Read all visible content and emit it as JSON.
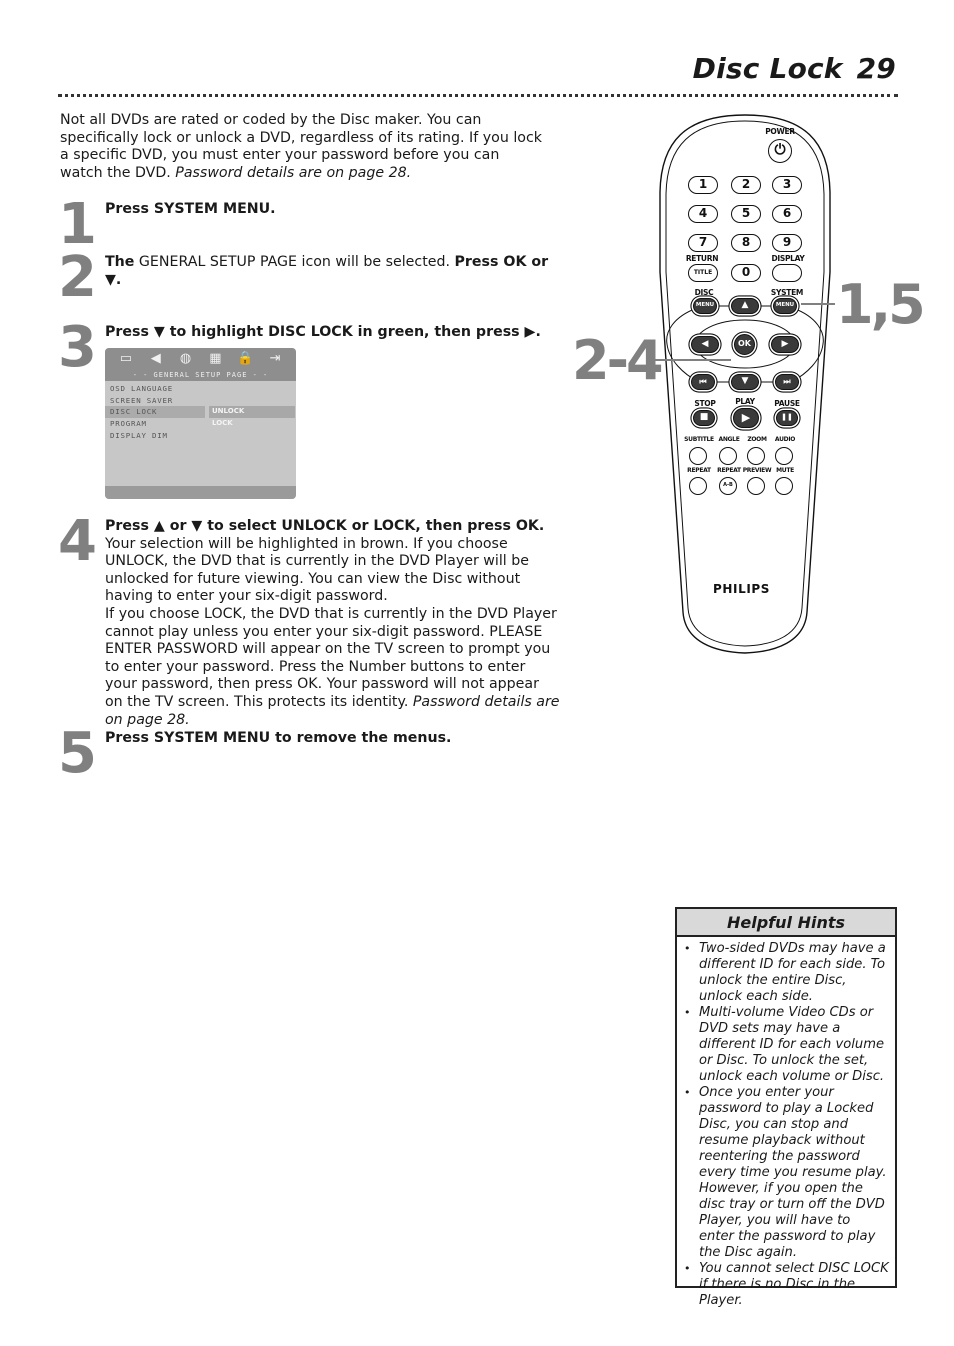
{
  "header": {
    "title": "Disc Lock",
    "page_number": "29"
  },
  "intro": {
    "text": "Not all DVDs are rated or coded by the Disc maker. You can specifically lock or unlock a DVD, regardless of its rating. If you lock a specific DVD, you must enter your password before you can watch the DVD. ",
    "italic_note": "Password details are on page 28."
  },
  "steps": [
    {
      "number": "1",
      "parts": [
        {
          "b": "Press SYSTEM MENU."
        }
      ]
    },
    {
      "number": "2",
      "parts": [
        {
          "b": "The"
        },
        {
          "t": " GENERAL SETUP PAGE icon will be selected. "
        },
        {
          "b": "Press OK or ▼."
        }
      ]
    },
    {
      "number": "3",
      "parts": [
        {
          "b": "Press ▼  to highlight DISC LOCK in green, then press ▶."
        }
      ]
    },
    {
      "number": "4",
      "parts": [
        {
          "b": "Press ▲ or ▼ to select UNLOCK or LOCK, then press OK."
        },
        {
          "t": " Your selection will be highlighted in brown. If you choose UNLOCK, the DVD that is currently in the DVD Player will be unlocked for future viewing. You can view the Disc without having to enter your six-digit password."
        },
        {
          "br": true
        },
        {
          "t": "If you choose LOCK, the DVD that is currently in the DVD Player cannot play unless you enter your six-digit password. PLEASE ENTER PASSWORD will appear on the TV screen to prompt you to enter your password. Press the Number buttons to enter your password, then press OK.  Your password will not appear on the TV screen. This protects its identity. "
        },
        {
          "i": "Password details are on page 28."
        }
      ]
    },
    {
      "number": "5",
      "parts": [
        {
          "b": "Press SYSTEM MENU to remove the menus."
        }
      ]
    }
  ],
  "osd": {
    "icons": [
      "tv-icon",
      "speaker-icon",
      "disc-icon",
      "picture-icon",
      "lock-icon",
      "exit-icon"
    ],
    "icon_glyphs": [
      "▭",
      "◀",
      "◍",
      "▦",
      "🔒",
      "⇥"
    ],
    "title": "- -  GENERAL  SETUP  PAGE  - -",
    "items": [
      "OSD LANGUAGE",
      "SCREEN SAVER",
      "DISC LOCK",
      "PROGRAM",
      "DISPLAY DIM"
    ],
    "selected_item": "DISC LOCK",
    "options": [
      "UNLOCK",
      "LOCK"
    ],
    "selected_option": "UNLOCK"
  },
  "remote": {
    "power_label": "POWER",
    "numbers": [
      "1",
      "2",
      "3",
      "4",
      "5",
      "6",
      "7",
      "8",
      "9"
    ],
    "zero": "0",
    "return_label": "RETURN",
    "title_button": "TITLE",
    "display_label": "DISPLAY",
    "disc_label": "DISC",
    "system_label": "SYSTEM",
    "menu_button": "MENU",
    "ok_button": "OK",
    "up": "▲",
    "down": "▼",
    "left": "◀",
    "right": "▶",
    "prev": "⏮",
    "next": "⏭",
    "stop_label": "STOP",
    "play_label": "PLAY",
    "pause_label": "PAUSE",
    "stop_glyph": "■",
    "play_glyph": "▶",
    "pause_glyph": "❚❚",
    "row1_labels": [
      "SUBTITLE",
      "ANGLE",
      "ZOOM",
      "AUDIO"
    ],
    "row2_labels": [
      "REPEAT",
      "REPEAT",
      "PREVIEW",
      "MUTE"
    ],
    "ab_button": "A-B",
    "brand": "PHILIPS"
  },
  "callouts": {
    "system_menu_steps": "1,5",
    "nav_steps": "2-4"
  },
  "hints": {
    "title": "Helpful Hints",
    "items": [
      "Two-sided DVDs may have a different ID for each side. To unlock the entire Disc, unlock each side.",
      "Multi-volume Video CDs or DVD sets may have a different ID for each volume or Disc. To unlock the set, unlock each volume or Disc.",
      "Once you enter your password to play a Locked Disc, you can stop and resume playback without reentering the password every time you resume play. However, if you open the disc tray or turn off the DVD Player, you will have to enter the password to play the Disc again.",
      "You cannot select DISC LOCK if there is no Disc in the Player."
    ]
  }
}
